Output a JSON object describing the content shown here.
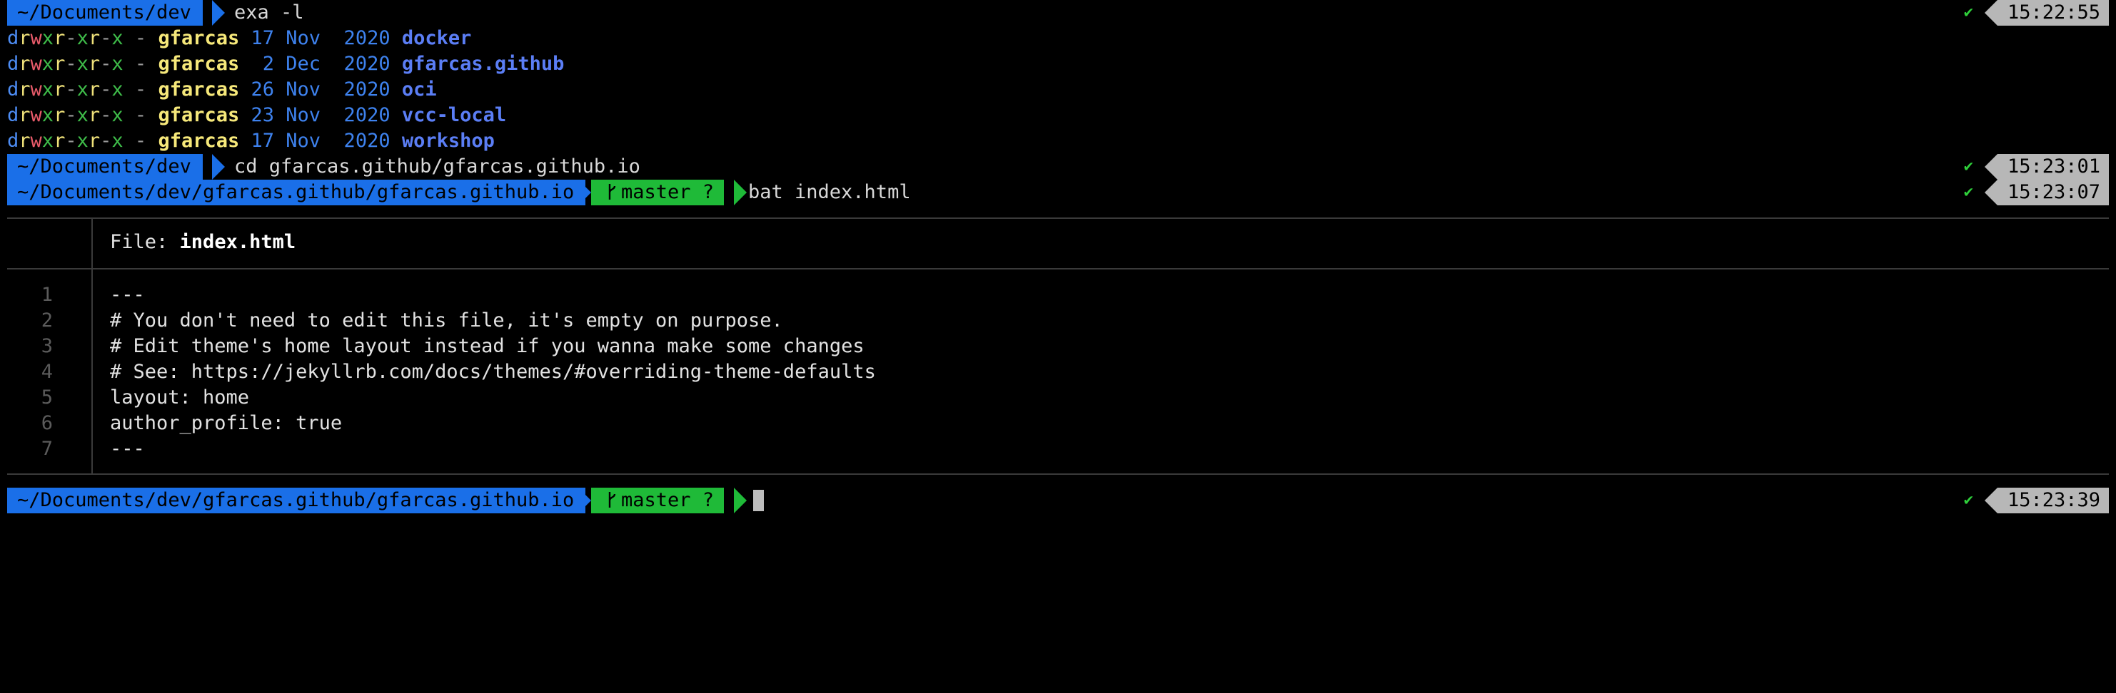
{
  "prompt1": {
    "path": "~/Documents/dev",
    "command": "exa -l",
    "time": "15:22:55"
  },
  "ls_rows": [
    {
      "perms": [
        "d",
        "r",
        "w",
        "x",
        "r",
        "-",
        "x",
        "r",
        "-",
        "x"
      ],
      "size": "-",
      "owner": "gfarcas",
      "date": "17 Nov  2020",
      "name": "docker"
    },
    {
      "perms": [
        "d",
        "r",
        "w",
        "x",
        "r",
        "-",
        "x",
        "r",
        "-",
        "x"
      ],
      "size": "-",
      "owner": "gfarcas",
      "date": " 2 Dec  2020",
      "name": "gfarcas.github"
    },
    {
      "perms": [
        "d",
        "r",
        "w",
        "x",
        "r",
        "-",
        "x",
        "r",
        "-",
        "x"
      ],
      "size": "-",
      "owner": "gfarcas",
      "date": "26 Nov  2020",
      "name": "oci"
    },
    {
      "perms": [
        "d",
        "r",
        "w",
        "x",
        "r",
        "-",
        "x",
        "r",
        "-",
        "x"
      ],
      "size": "-",
      "owner": "gfarcas",
      "date": "23 Nov  2020",
      "name": "vcc-local"
    },
    {
      "perms": [
        "d",
        "r",
        "w",
        "x",
        "r",
        "-",
        "x",
        "r",
        "-",
        "x"
      ],
      "size": "-",
      "owner": "gfarcas",
      "date": "17 Nov  2020",
      "name": "workshop"
    }
  ],
  "prompt2": {
    "path": "~/Documents/dev",
    "command": "cd gfarcas.github/gfarcas.github.io",
    "time": "15:23:01"
  },
  "prompt3": {
    "path": "~/Documents/dev/gfarcas.github/gfarcas.github.io",
    "branch": "master ?",
    "command": "bat index.html",
    "time": "15:23:07"
  },
  "bat": {
    "file_label": "File: ",
    "file_name": "index.html",
    "lines": [
      {
        "n": "1",
        "text": "---"
      },
      {
        "n": "2",
        "text": "# You don't need to edit this file, it's empty on purpose."
      },
      {
        "n": "3",
        "text": "# Edit theme's home layout instead if you wanna make some changes"
      },
      {
        "n": "4",
        "text": "# See: https://jekyllrb.com/docs/themes/#overriding-theme-defaults"
      },
      {
        "n": "5",
        "text": "layout: home"
      },
      {
        "n": "6",
        "text": "author_profile: true"
      },
      {
        "n": "7",
        "text": "---"
      }
    ]
  },
  "prompt4": {
    "path": "~/Documents/dev/gfarcas.github/gfarcas.github.io",
    "branch": "master ?",
    "command": "",
    "time": "15:23:39"
  },
  "status_symbol": "✔",
  "colors": {
    "path_bg": "#1a6fe8",
    "git_bg": "#1fba38",
    "time_bg": "#b7b7b7",
    "check": "#2fd13b",
    "owner": "#f6e87a",
    "date": "#3e82ee",
    "dirname": "#5b7ef5"
  },
  "icons": {
    "git_branch": "git-branch-icon",
    "status": "check-icon"
  }
}
